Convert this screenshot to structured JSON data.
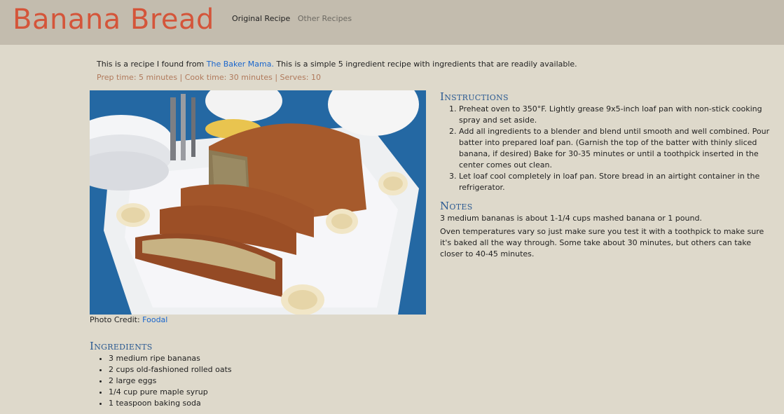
{
  "header": {
    "site_title": "Banana Bread",
    "nav": [
      {
        "label": "Original Recipe",
        "active": true
      },
      {
        "label": "Other Recipes",
        "active": false
      }
    ]
  },
  "intro": {
    "before_link": "This is a recipe I found from ",
    "link_text": "The Baker Mama.",
    "after_link": " This is a simple 5 ingredient recipe with ingredients that are readily available."
  },
  "meta": "Prep time: 5 minutes | Cook time: 30 minutes | Serves: 10",
  "photo": {
    "credit_label": "Photo Credit: ",
    "credit_link": "Foodal"
  },
  "instructions": {
    "heading": "Instructions",
    "steps": [
      "Preheat oven to 350°F. Lightly grease 9x5-inch loaf pan with non-stick cooking spray and set aside.",
      "Add all ingredients to a blender and blend until smooth and well combined. Pour batter into prepared loaf pan. (Garnish the top of the batter with thinly sliced banana, if desired) Bake for 30-35 minutes or until a toothpick inserted in the center comes out clean.",
      "Let loaf cool completely in loaf pan. Store bread in an airtight container in the refrigerator."
    ]
  },
  "notes": {
    "heading": "Notes",
    "items": [
      "3 medium bananas is about 1-1/4 cups mashed banana or 1 pound.",
      "Oven temperatures vary so just make sure you test it with a toothpick to make sure it's baked all the way through. Some take about 30 minutes, but others can take closer to 40-45 minutes."
    ]
  },
  "ingredients": {
    "heading": "Ingredients",
    "items": [
      "3 medium ripe bananas",
      "2 cups old-fashioned rolled oats",
      "2 large eggs",
      "1/4 cup pure maple syrup",
      "1 teaspoon baking soda"
    ]
  },
  "colors": {
    "background": "#ded9cb",
    "header": "#c3bcae",
    "title": "#d4553a",
    "heading": "#2b5a92",
    "link": "#1a66cc",
    "meta": "#b07a5c"
  }
}
